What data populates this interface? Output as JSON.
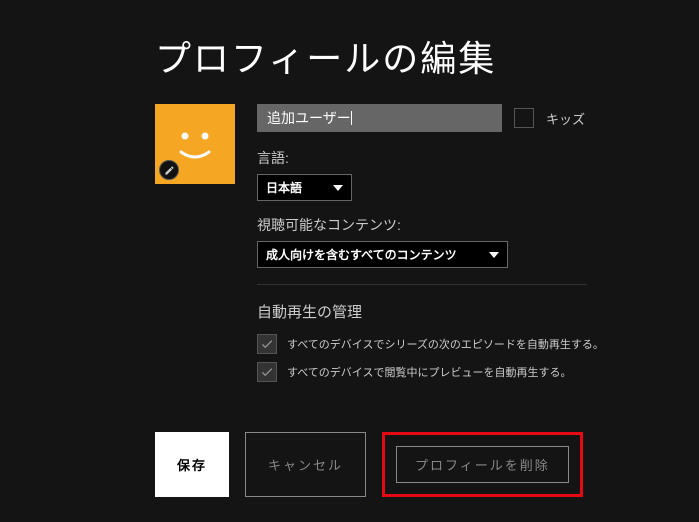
{
  "title": "プロフィールの編集",
  "profile": {
    "name_value": "追加ユーザー",
    "kids_label": "キッズ"
  },
  "language": {
    "label": "言語:",
    "selected": "日本語"
  },
  "maturity": {
    "label": "視聴可能なコンテンツ:",
    "selected": "成人向けを含むすべてのコンテンツ"
  },
  "autoplay": {
    "heading": "自動再生の管理",
    "opt_next": "すべてのデバイスでシリーズの次のエピソードを自動再生する。",
    "opt_preview": "すべてのデバイスで閲覧中にプレビューを自動再生する。"
  },
  "buttons": {
    "save": "保存",
    "cancel": "キャンセル",
    "delete": "プロフィールを削除"
  }
}
